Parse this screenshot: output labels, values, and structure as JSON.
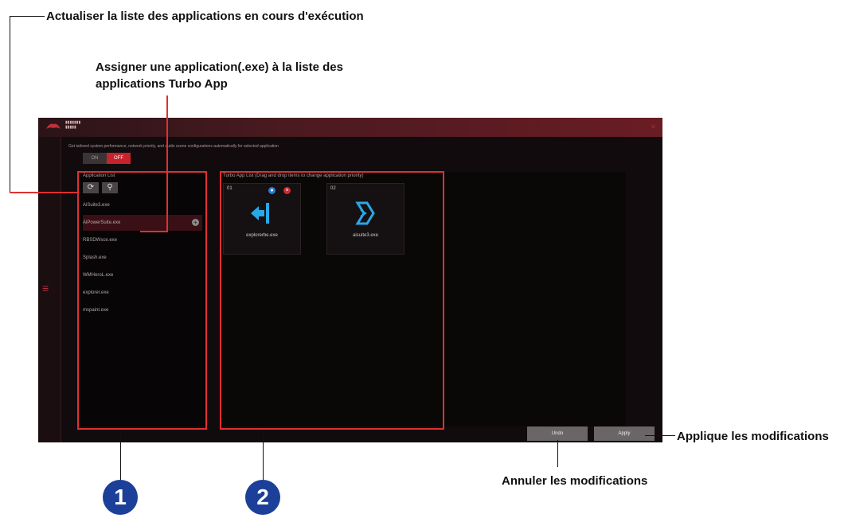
{
  "annotations": {
    "refresh": "Actualiser la liste des applications en cours d'exécution",
    "assign_line1": "Assigner une application(.exe) à la liste des",
    "assign_line2": "applications Turbo App",
    "apply": "Applique les modifications",
    "undo": "Annuler les modifications"
  },
  "badges": [
    "1",
    "2"
  ],
  "window": {
    "close_icon": "×",
    "menu_icon": "≡",
    "description": "Get tailored system performance, network priority, and audio scene configurations automatically for selected application",
    "toggle": {
      "on_label": "ON",
      "off_label": "OFF",
      "state": "OFF"
    }
  },
  "app_list": {
    "title": "Application List",
    "refresh_icon": "⟳",
    "search_icon": "⚲",
    "items": [
      {
        "label": "AiSuite3.exe"
      },
      {
        "label": "AiPowerSuite.exe",
        "selected": true
      },
      {
        "label": "RBSDWsce.exe"
      },
      {
        "label": "Splash.exe"
      },
      {
        "label": "WMHeroL.exe"
      },
      {
        "label": "explorer.exe"
      },
      {
        "label": "mspaint.exe"
      }
    ],
    "add_icon": "+"
  },
  "turbo_list": {
    "title": "Turbo App List (Drag and drop items to change application priority)",
    "tiles": [
      {
        "num": "01",
        "name": "explorerbe.exe",
        "icon": "arrow-left-icon"
      },
      {
        "num": "02",
        "name": "aisuite3.exe",
        "icon": "aisuite-icon"
      }
    ]
  },
  "buttons": {
    "undo": "Undo",
    "apply": "Apply"
  },
  "colors": {
    "accent": "#c8222c",
    "highlight": "#e03030",
    "badge": "#1c3f99",
    "icon_blue": "#29a8e8"
  }
}
